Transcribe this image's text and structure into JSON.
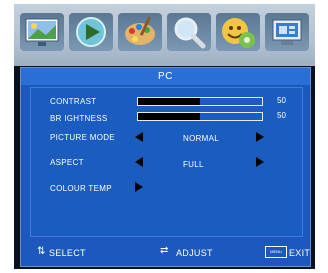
{
  "osd": {
    "title": "PC",
    "icons": [
      "picture-icon",
      "play-icon",
      "palette-icon",
      "magnifier-icon",
      "face-icon",
      "computer-icon"
    ],
    "contrast": {
      "label": "CONTRAST",
      "value": "50",
      "level": 0.5
    },
    "brightness": {
      "label": "BR IGHTNESS",
      "value": "50",
      "level": 0.5
    },
    "picture_mode": {
      "label": "PICTURE  MODE",
      "value": "NORMAL"
    },
    "aspect": {
      "label": "ASPECT",
      "value": "FULL"
    },
    "colour_temp": {
      "label": "COLOUR TEMP"
    },
    "footer": {
      "select": "SELECT",
      "adjust": "ADJUST",
      "menu": "MENU",
      "exit": "EXIT"
    }
  }
}
